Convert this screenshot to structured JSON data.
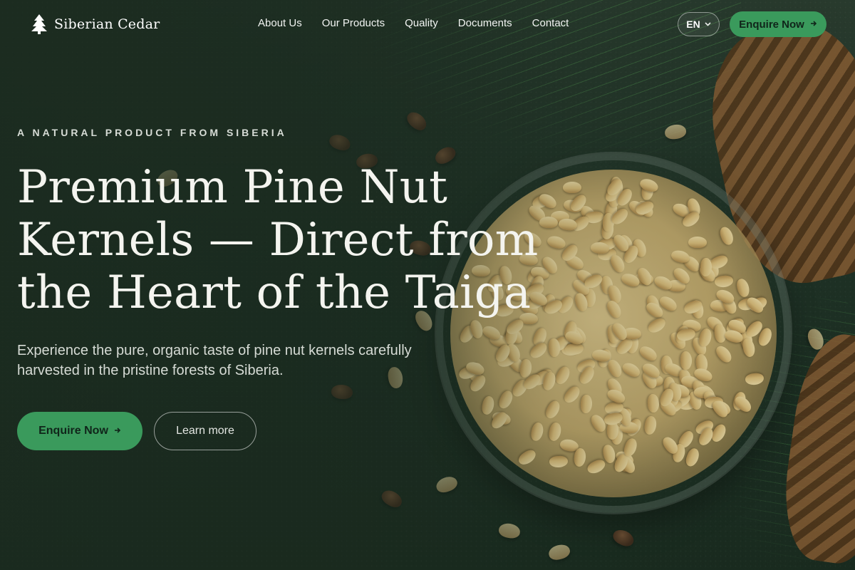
{
  "header": {
    "brand": "Siberian Cedar",
    "nav": [
      "About Us",
      "Our Products",
      "Quality",
      "Documents",
      "Contact"
    ],
    "language": "EN",
    "cta_label": "Enquire Now"
  },
  "hero": {
    "eyebrow": "A NATURAL PRODUCT FROM SIBERIA",
    "title": "Premium Pine Nut Kernels — Direct from the Heart of the Taiga",
    "subtitle": "Experience the pure, organic taste of pine nut kernels carefully harvested in the pristine forests of Siberia.",
    "primary_button": "Enquire Now",
    "secondary_button": "Learn more"
  },
  "icons": {
    "logo": "pine-tree-icon",
    "language_dropdown": "chevron-down-icon",
    "button_arrow": "arrow-right-icon"
  },
  "colors": {
    "accent": "#3a9a5c",
    "background": "#1f3226"
  }
}
